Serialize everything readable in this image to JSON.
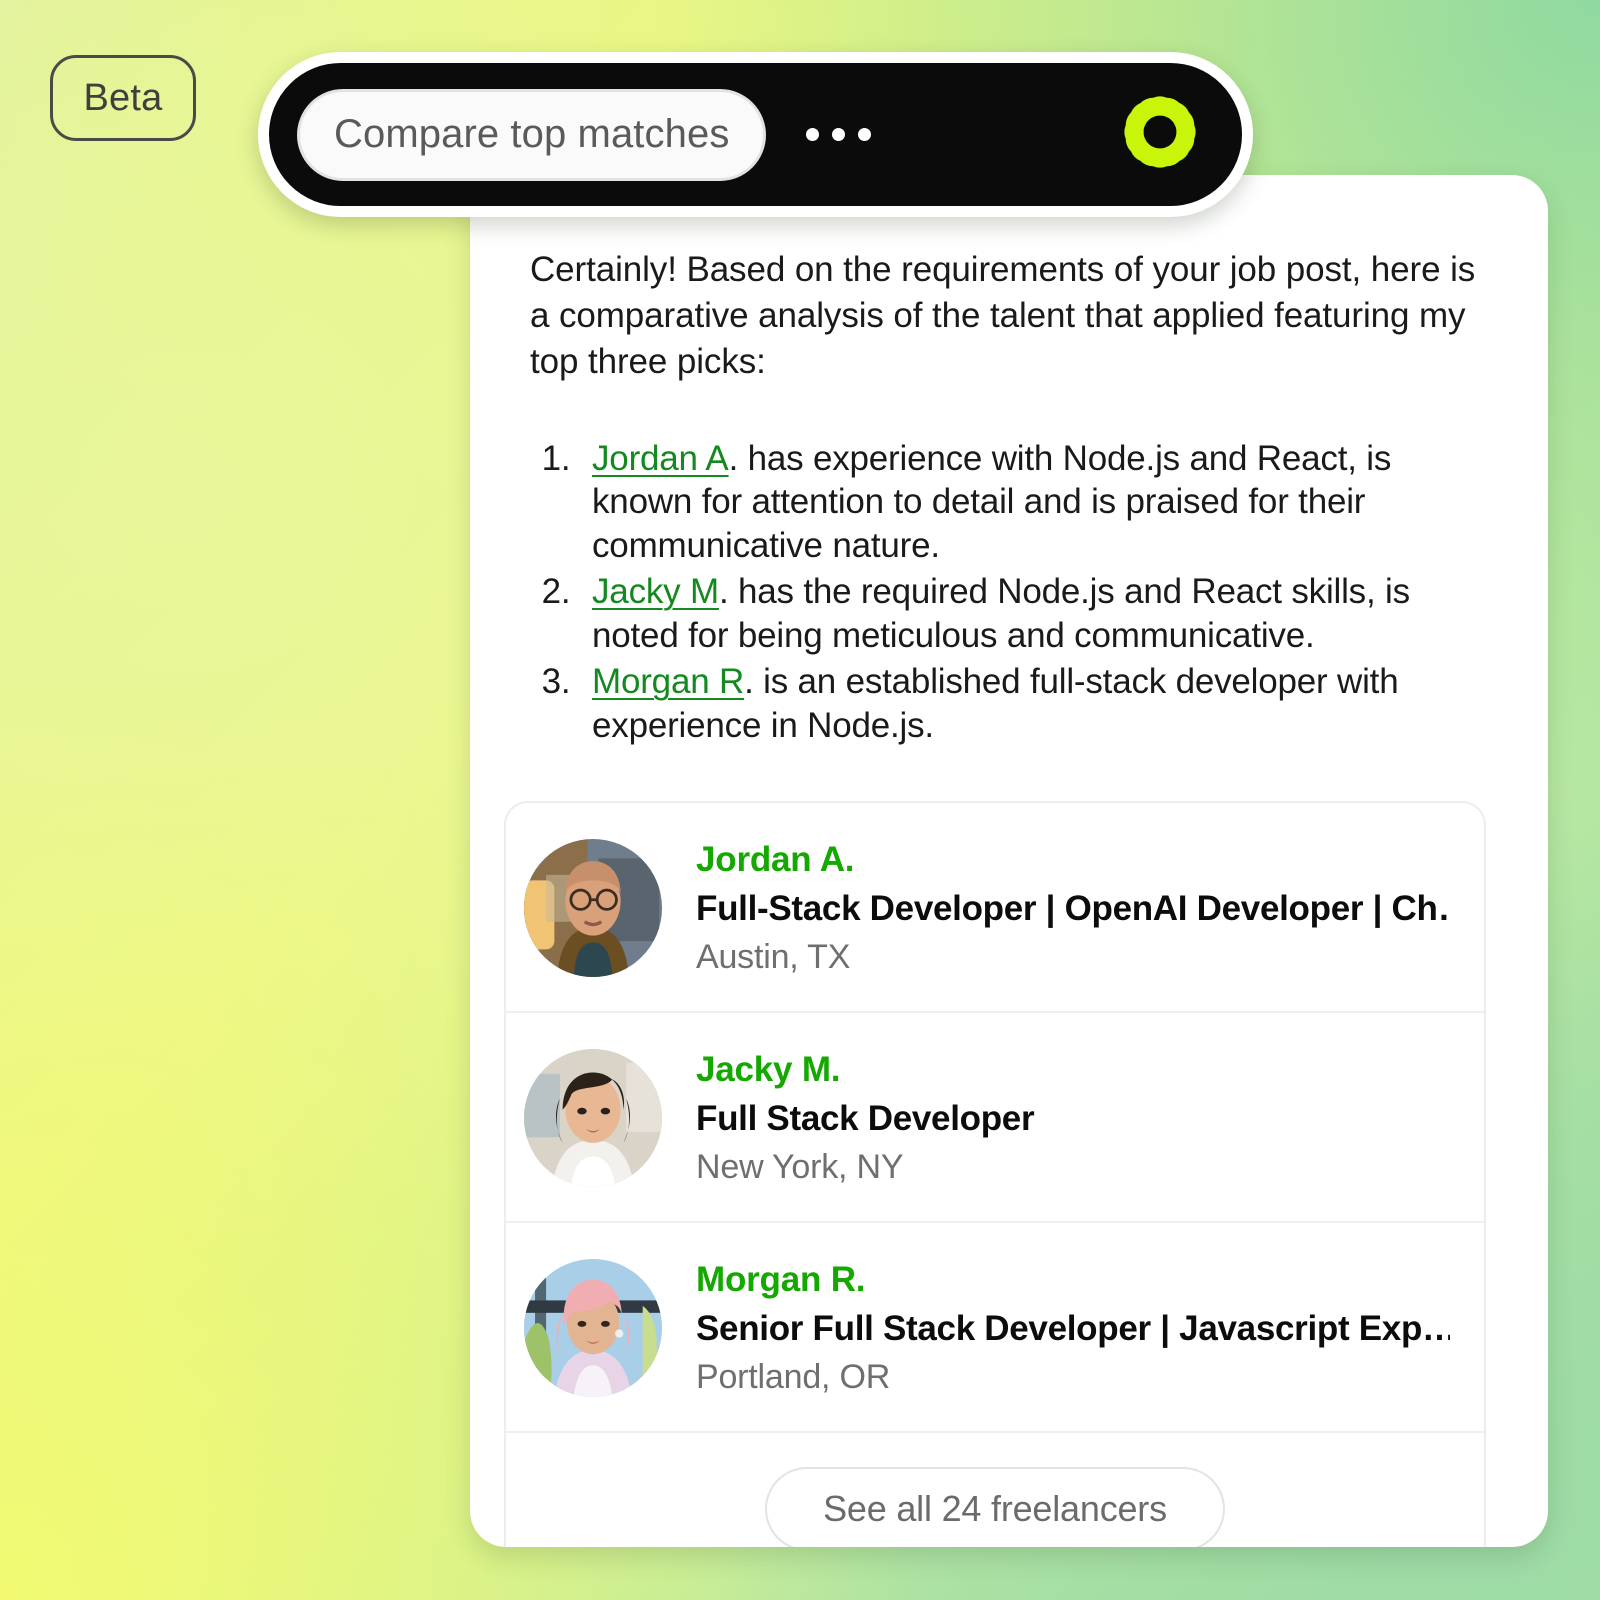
{
  "badge": {
    "label": "Beta"
  },
  "command_bar": {
    "chip_label": "Compare top matches",
    "menu_dots": "•••",
    "logo_name": "rosette-logo-icon",
    "logo_color": "#c8f50a",
    "background_color": "#0b0b0b"
  },
  "response": {
    "intro": "Certainly! Based on the requirements of your job post, here is a comparative analysis of the talent that applied featuring my top three picks:",
    "picks": [
      {
        "number": "1.",
        "link": "Jordan A",
        "text": ". has experience with Node.js and React, is known for attention to detail and is praised for their communicative nature."
      },
      {
        "number": "2.",
        "link": "Jacky M",
        "text": ". has the required Node.js and React skills, is noted for being meticulous and communicative."
      },
      {
        "number": "3.",
        "link": "Morgan R",
        "text": ". is an established full-stack developer with experience in Node.js."
      }
    ],
    "link_color": "#14891f"
  },
  "freelancers": [
    {
      "name": "Jordan A.",
      "title": "Full-Stack Developer | OpenAI Developer | Ch…",
      "location": "Austin, TX",
      "avatar_name": "avatar-jordan-a"
    },
    {
      "name": "Jacky M.",
      "title": "Full Stack Developer",
      "location": "New York, NY",
      "avatar_name": "avatar-jacky-m"
    },
    {
      "name": "Morgan R.",
      "title": "Senior Full Stack Developer | Javascript Exp…",
      "location": "Portland, OR",
      "avatar_name": "avatar-morgan-r"
    }
  ],
  "footer": {
    "see_all_label": "See all 24 freelancers"
  }
}
